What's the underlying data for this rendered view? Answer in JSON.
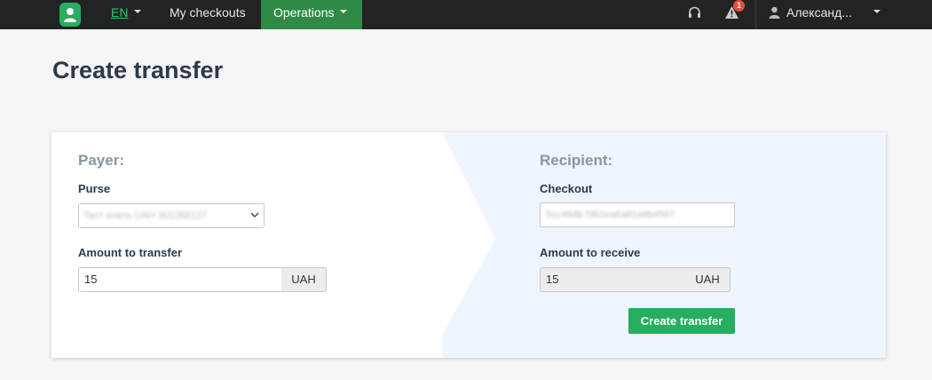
{
  "navbar": {
    "logo_icon": "user-avatar-icon",
    "language": "EN",
    "my_checkouts": "My checkouts",
    "operations": "Operations",
    "support_icon": "headset-icon",
    "alerts_icon": "warning-icon",
    "alerts_count": "1",
    "user_icon": "user-icon",
    "user_name": "Александ..."
  },
  "page": {
    "title": "Create transfer"
  },
  "payer": {
    "title": "Payer:",
    "purse_label": "Purse",
    "purse_value": "Тест олеть UAH 301268127",
    "amount_label": "Amount to transfer",
    "amount_value": "15",
    "currency": "UAH"
  },
  "recipient": {
    "title": "Recipient:",
    "checkout_label": "Checkout",
    "checkout_value": "5cc46db f3b1ea6a81e8b4567",
    "amount_label": "Amount to receive",
    "amount_value": "15",
    "currency": "UAH",
    "submit_label": "Create transfer"
  },
  "colors": {
    "navbar_bg": "#222324",
    "active_nav": "#2f8a45",
    "accent": "#27ae60",
    "recipient_bg": "#eef5fe",
    "badge": "#e74c3c"
  }
}
